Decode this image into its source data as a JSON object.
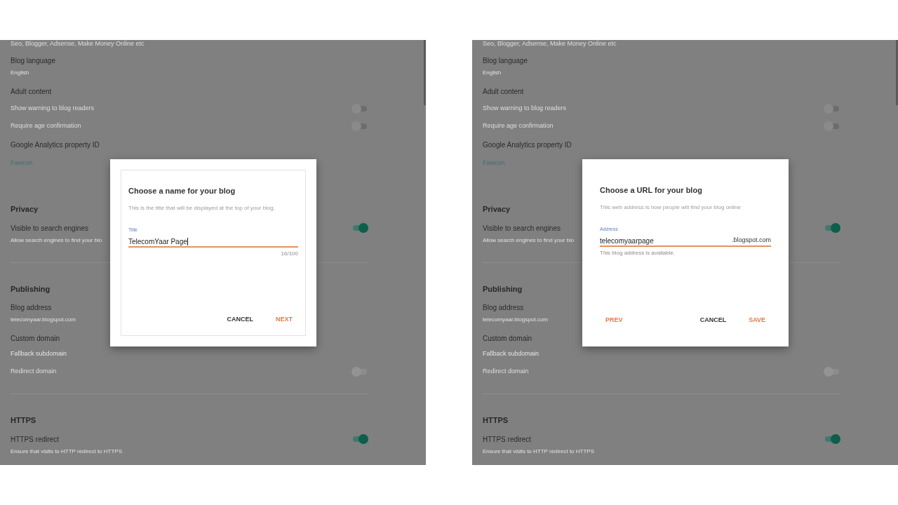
{
  "panels": [
    {
      "settings": [
        {
          "kind": "caption",
          "text": "Seo, Blogger, Adsense, Make Money Online etc"
        },
        {
          "kind": "label",
          "text": "Blog language"
        },
        {
          "kind": "value",
          "text": "English"
        },
        {
          "kind": "label",
          "text": "Adult content"
        },
        {
          "kind": "option",
          "text": "Show warning to blog readers",
          "on": false,
          "disabled": false
        },
        {
          "kind": "option",
          "text": "Require age confirmation",
          "on": false,
          "disabled": false
        },
        {
          "kind": "label",
          "text": "Google Analytics property ID"
        },
        {
          "kind": "link",
          "text": "Favicon"
        },
        {
          "kind": "heading",
          "text": "Privacy"
        },
        {
          "kind": "toggle",
          "text": "Visible to search engines",
          "on": true,
          "disabled": false
        },
        {
          "kind": "value",
          "text": "Allow search engines to find your blo"
        },
        {
          "kind": "divider"
        },
        {
          "kind": "heading",
          "text": "Publishing"
        },
        {
          "kind": "label",
          "text": "Blog address"
        },
        {
          "kind": "value",
          "text": "telecomyaar.blogspot.com"
        },
        {
          "kind": "label",
          "text": "Custom domain"
        },
        {
          "kind": "inactive",
          "text": "Fallback subdomain"
        },
        {
          "kind": "option",
          "text": "Redirect domain",
          "on": false,
          "disabled": true
        },
        {
          "kind": "divider"
        },
        {
          "kind": "heading",
          "text": "HTTPS"
        },
        {
          "kind": "toggle",
          "text": "HTTPS redirect",
          "on": true,
          "disabled": false
        },
        {
          "kind": "value",
          "text": "Ensure that visits to HTTP redirect to HTTPS"
        }
      ],
      "dialog": {
        "framed": true,
        "title": "Choose a name for your blog",
        "description": "This is the title that will be displayed at the top of your blog.",
        "field": {
          "label": "Title",
          "value": "TelecomYaar Page",
          "cursor": true,
          "counter": "16/100"
        },
        "right_buttons": [
          {
            "label": "CANCEL",
            "kind": "secondary"
          },
          {
            "label": "NEXT",
            "kind": "primary"
          }
        ]
      }
    },
    {
      "settings": [
        {
          "kind": "caption",
          "text": "Seo, Blogger, Adsense, Make Money Online etc"
        },
        {
          "kind": "label",
          "text": "Blog language"
        },
        {
          "kind": "value",
          "text": "English"
        },
        {
          "kind": "label",
          "text": "Adult content"
        },
        {
          "kind": "option",
          "text": "Show warning to blog readers",
          "on": false,
          "disabled": false
        },
        {
          "kind": "option",
          "text": "Require age confirmation",
          "on": false,
          "disabled": false
        },
        {
          "kind": "label",
          "text": "Google Analytics property ID"
        },
        {
          "kind": "link",
          "text": "Favicon"
        },
        {
          "kind": "heading",
          "text": "Privacy"
        },
        {
          "kind": "toggle",
          "text": "Visible to search engines",
          "on": true,
          "disabled": false
        },
        {
          "kind": "value",
          "text": "Allow search engines to find your blo"
        },
        {
          "kind": "divider"
        },
        {
          "kind": "heading",
          "text": "Publishing"
        },
        {
          "kind": "label",
          "text": "Blog address"
        },
        {
          "kind": "value",
          "text": "telecomyaar.blogspot.com"
        },
        {
          "kind": "label",
          "text": "Custom domain"
        },
        {
          "kind": "inactive",
          "text": "Fallback subdomain"
        },
        {
          "kind": "option",
          "text": "Redirect domain",
          "on": false,
          "disabled": true
        },
        {
          "kind": "divider"
        },
        {
          "kind": "heading",
          "text": "HTTPS"
        },
        {
          "kind": "toggle",
          "text": "HTTPS redirect",
          "on": true,
          "disabled": false
        },
        {
          "kind": "value",
          "text": "Ensure that visits to HTTP redirect to HTTPS"
        }
      ],
      "dialog": {
        "framed": false,
        "title": "Choose a URL for your blog",
        "description": "This web address is how people will find your blog online",
        "field": {
          "label": "Address",
          "value": "telecomyaarpage",
          "suffix": ".blogspot.com",
          "cursor": false,
          "helper": "This blog address is available."
        },
        "left_buttons": [
          {
            "label": "PREV",
            "kind": "primary"
          }
        ],
        "right_buttons": [
          {
            "label": "CANCEL",
            "kind": "secondary"
          },
          {
            "label": "SAVE",
            "kind": "primary"
          }
        ]
      }
    }
  ]
}
